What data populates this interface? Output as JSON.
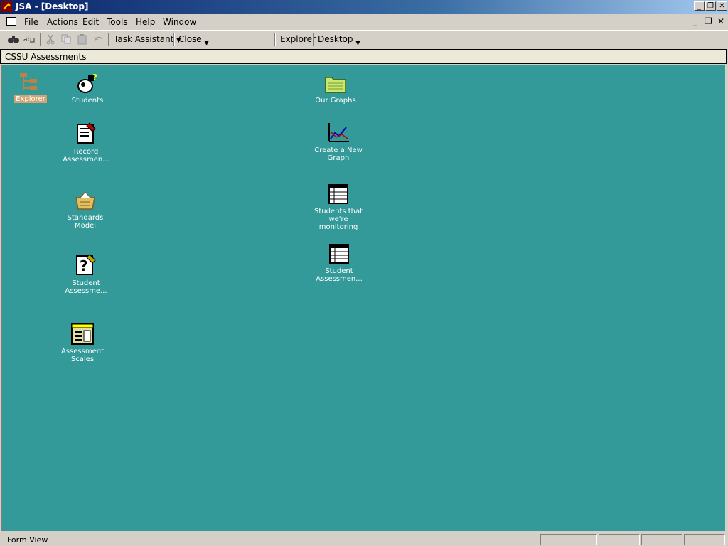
{
  "window": {
    "title": "JSA - [Desktop]"
  },
  "menu": {
    "items": [
      {
        "label": "File"
      },
      {
        "label": "Actions"
      },
      {
        "label": "Edit"
      },
      {
        "label": "Tools"
      },
      {
        "label": "Help"
      },
      {
        "label": "Window"
      }
    ]
  },
  "toolbar": {
    "task_assistant": "Task Assistant",
    "close": "Close",
    "explorer": "Explorer",
    "desktop": "Desktop"
  },
  "header": {
    "title": "CSSU Assessments"
  },
  "desktop": {
    "icons": [
      {
        "label": "Explorer",
        "icon": "explorer-tree-icon",
        "selected": true
      },
      {
        "label": "Students",
        "icon": "students-icon"
      },
      {
        "label": "Record Assessmen...",
        "icon": "notepad-icon"
      },
      {
        "label": "Standards Model",
        "icon": "basket-icon"
      },
      {
        "label": "Student Assessme...",
        "icon": "question-notepad-icon"
      },
      {
        "label": "Assessment Scales",
        "icon": "calculator-icon"
      },
      {
        "label": "Our Graphs",
        "icon": "folder-icon"
      },
      {
        "label": "Create a New Graph",
        "icon": "graph-icon"
      },
      {
        "label": "Students that we're monitoring",
        "icon": "table-icon"
      },
      {
        "label": "Student Assessmen...",
        "icon": "table-icon"
      }
    ]
  },
  "status": {
    "text": "Form View"
  },
  "colors": {
    "desktop_bg": "#339999",
    "title_start": "#0a246a",
    "selected_label": "#d4a373"
  }
}
